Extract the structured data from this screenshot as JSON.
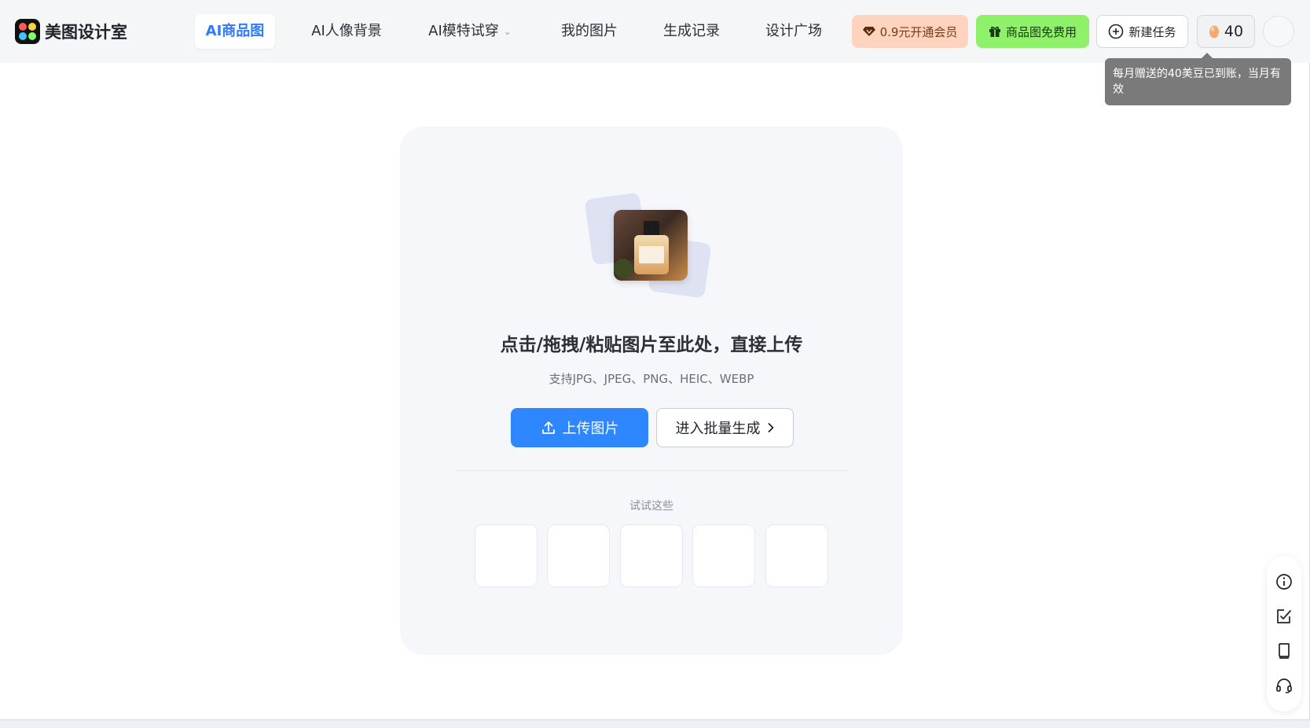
{
  "app": {
    "name": "美图设计室"
  },
  "nav": {
    "items": [
      {
        "label": "AI商品图",
        "active": true
      },
      {
        "label": "AI人像背景",
        "active": false
      },
      {
        "label": "AI模特试穿",
        "active": false,
        "has_dropdown": true
      },
      {
        "label": "我的图片",
        "active": false
      },
      {
        "label": "生成记录",
        "active": false
      },
      {
        "label": "设计广场",
        "active": false
      }
    ]
  },
  "header": {
    "vip_label": "0.9元开通会员",
    "free_label": "商品图免费用",
    "new_task_label": "新建任务",
    "beans_count": "40",
    "tooltip": "每月赠送的40美豆已到账，当月有效"
  },
  "upload": {
    "headline": "点击/拖拽/粘贴图片至此处，直接上传",
    "formats": "支持JPG、JPEG、PNG、HEIC、WEBP",
    "upload_button": "上传图片",
    "batch_button": "进入批量生成",
    "try_label": "试试这些"
  },
  "colors": {
    "accent": "#2f87ff",
    "vip_bg": "#ffd4bf",
    "free_bg": "#8ff06a",
    "tooltip_bg": "#7a7a7a"
  },
  "icons": {
    "logo": "app-logo-icon",
    "vip": "diamond-icon",
    "free": "gift-icon",
    "new_task": "plus-circle-icon",
    "beans": "bean-icon",
    "upload": "upload-icon",
    "batch": "chevron-right-icon",
    "side": [
      "info-icon",
      "edit-icon",
      "book-icon",
      "headset-icon"
    ]
  }
}
